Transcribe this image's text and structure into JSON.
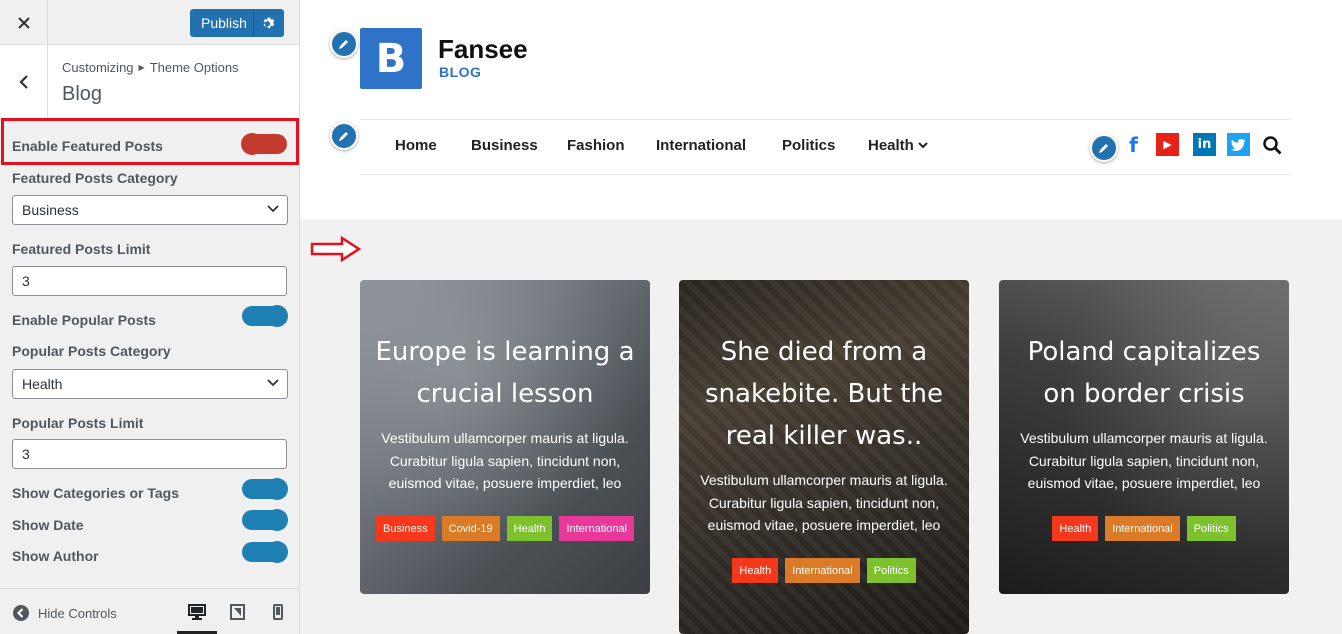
{
  "sidebar": {
    "publish_label": "Publish",
    "breadcrumb": {
      "root": "Customizing",
      "parent": "Theme Options"
    },
    "section_title": "Blog",
    "settings": {
      "enable_featured": {
        "label": "Enable Featured Posts",
        "enabled": false
      },
      "featured_category": {
        "label": "Featured Posts Category",
        "value": "Business"
      },
      "featured_limit": {
        "label": "Featured Posts Limit",
        "value": "3"
      },
      "enable_popular": {
        "label": "Enable Popular Posts",
        "enabled": true
      },
      "popular_category": {
        "label": "Popular Posts Category",
        "value": "Health"
      },
      "popular_limit": {
        "label": "Popular Posts Limit",
        "value": "3"
      },
      "show_categories": {
        "label": "Show Categories or Tags",
        "enabled": true
      },
      "show_date": {
        "label": "Show Date",
        "enabled": true
      },
      "show_author": {
        "label": "Show Author",
        "enabled": true
      }
    },
    "hide_controls_label": "Hide Controls",
    "devices": [
      "desktop-icon",
      "tablet-icon",
      "mobile-icon"
    ]
  },
  "site": {
    "logo_letter": "B",
    "name": "Fansee",
    "tagline": "BLOG",
    "nav": [
      "Home",
      "Business",
      "Fashion",
      "International",
      "Politics",
      "Health"
    ],
    "social": [
      {
        "name": "facebook-icon",
        "glyph": "f",
        "color": "#1877f2"
      },
      {
        "name": "youtube-icon",
        "glyph": "▶",
        "color": "#e62117"
      },
      {
        "name": "linkedin-icon",
        "glyph": "in",
        "color": "#0077b5"
      },
      {
        "name": "twitter-icon",
        "glyph": "🐦",
        "color": "#1da1f2"
      }
    ]
  },
  "cards": [
    {
      "title": "Europe is learning a crucial lesson",
      "excerpt": "Vestibulum ullamcorper mauris at ligula. Curabitur ligula sapien, tincidunt non, euismod vitae, posuere imperdiet, leo",
      "tags": [
        {
          "label": "Business",
          "color": "#f4381c"
        },
        {
          "label": "Covid-19",
          "color": "#db7a27"
        },
        {
          "label": "Health",
          "color": "#7dc12c"
        },
        {
          "label": "International",
          "color": "#e8389a"
        }
      ]
    },
    {
      "title": "She died from a snakebite. But the real killer was..",
      "excerpt": "Vestibulum ullamcorper mauris at ligula. Curabitur ligula sapien, tincidunt non, euismod vitae, posuere imperdiet, leo",
      "tags": [
        {
          "label": "Health",
          "color": "#f4381c"
        },
        {
          "label": "International",
          "color": "#db7a27"
        },
        {
          "label": "Politics",
          "color": "#7dc12c"
        }
      ]
    },
    {
      "title": "Poland capitalizes on border crisis",
      "excerpt": "Vestibulum ullamcorper mauris at ligula. Curabitur ligula sapien, tincidunt non, euismod vitae, posuere imperdiet, leo",
      "tags": [
        {
          "label": "Health",
          "color": "#f4381c"
        },
        {
          "label": "International",
          "color": "#db7a27"
        },
        {
          "label": "Politics",
          "color": "#7dc12c"
        }
      ]
    }
  ],
  "colors": {
    "accent": "#2271b1",
    "highlight": "#e3101f",
    "toggle_on": "#1e80b2",
    "toggle_off": "#c43a2f"
  }
}
